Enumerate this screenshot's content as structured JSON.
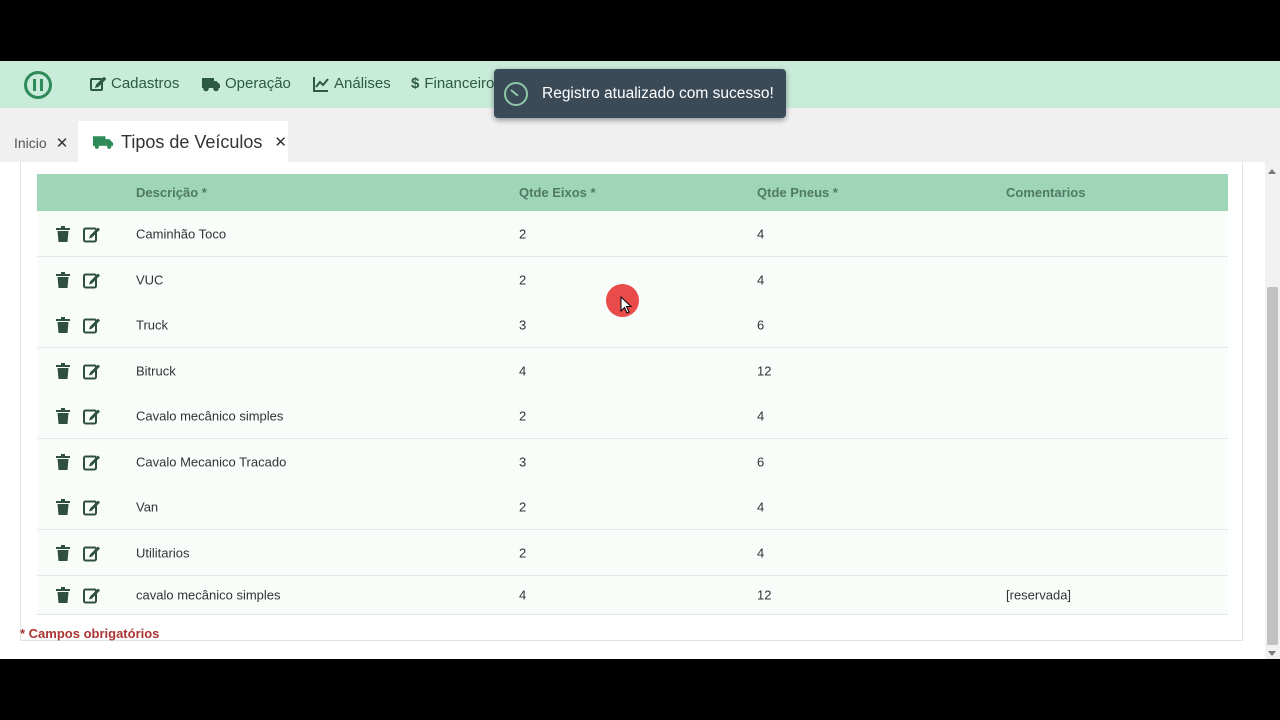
{
  "nav": {
    "items": [
      {
        "label": "Cadastros",
        "icon": "edit-icon"
      },
      {
        "label": "Operação",
        "icon": "truck-icon"
      },
      {
        "label": "Análises",
        "icon": "chart-line-icon"
      },
      {
        "label": "Financeiro",
        "icon": "dollar-icon"
      }
    ]
  },
  "toast": {
    "message": "Registro atualizado com sucesso!"
  },
  "tabs": {
    "home_label": "Inicio",
    "active_label": "Tipos de Veículos"
  },
  "table": {
    "headers": [
      "Descrição *",
      "Qtde Eixos *",
      "Qtde Pneus *",
      "Comentarios"
    ],
    "rows": [
      {
        "descricao": "Caminhão Toco",
        "eixos": "2",
        "pneus": "4",
        "comentarios": ""
      },
      {
        "descricao": "VUC",
        "eixos": "2",
        "pneus": "4",
        "comentarios": ""
      },
      {
        "descricao": "Truck",
        "eixos": "3",
        "pneus": "6",
        "comentarios": ""
      },
      {
        "descricao": "Bitruck",
        "eixos": "4",
        "pneus": "12",
        "comentarios": ""
      },
      {
        "descricao": "Cavalo mecânico simples",
        "eixos": "2",
        "pneus": "4",
        "comentarios": ""
      },
      {
        "descricao": "Cavalo Mecanico Tracado",
        "eixos": "3",
        "pneus": "6",
        "comentarios": ""
      },
      {
        "descricao": "Van",
        "eixos": "2",
        "pneus": "4",
        "comentarios": ""
      },
      {
        "descricao": "Utilitarios",
        "eixos": "2",
        "pneus": "4",
        "comentarios": ""
      },
      {
        "descricao": "cavalo mecânico simples",
        "eixos": "4",
        "pneus": "12",
        "comentarios": "[reservada]"
      }
    ]
  },
  "footnote": "* Campos obrigatórios",
  "colors": {
    "nav_bg": "#c8ecd9",
    "table_header_bg": "#9fd6b8",
    "toast_bg": "#3a4a57",
    "footnote": "#aa3333"
  }
}
